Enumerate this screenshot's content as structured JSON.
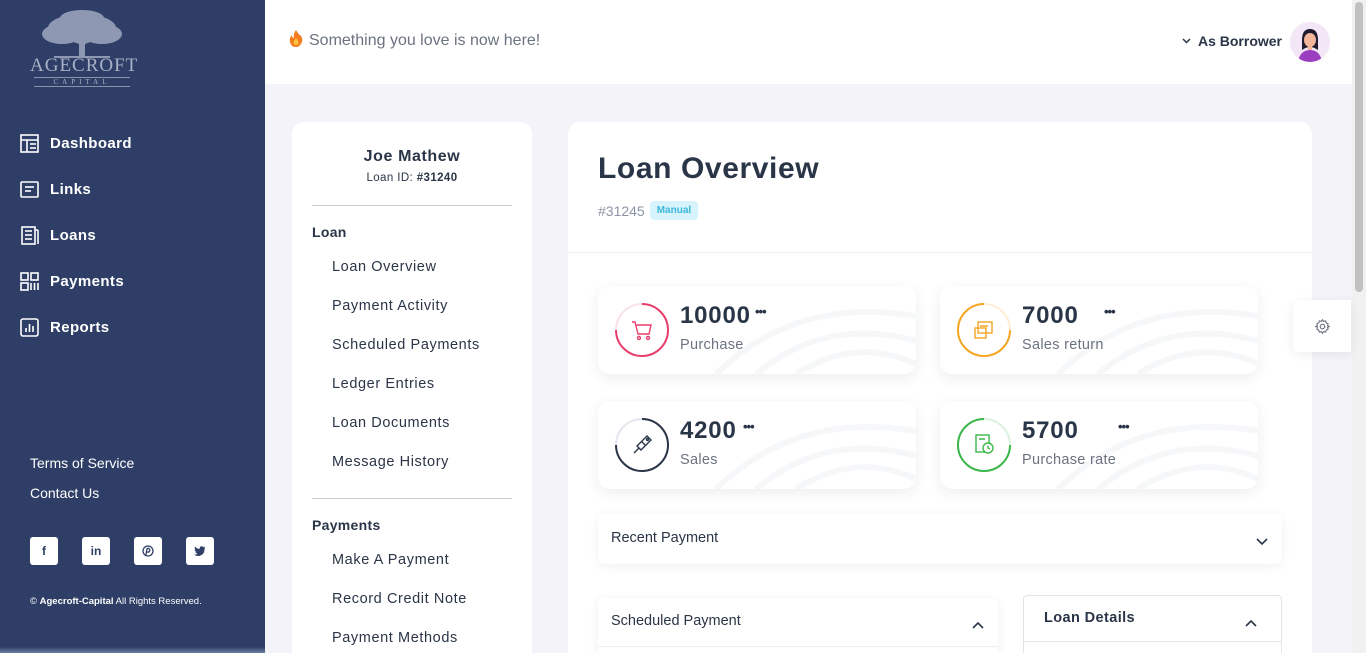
{
  "brand": {
    "name": "AGECROFT",
    "sub": "CAPITAL"
  },
  "sidebar": {
    "items": [
      {
        "label": "Dashboard",
        "icon": "dashboard-icon"
      },
      {
        "label": "Links",
        "icon": "links-icon"
      },
      {
        "label": "Loans",
        "icon": "loans-icon"
      },
      {
        "label": "Payments",
        "icon": "payments-icon"
      },
      {
        "label": "Reports",
        "icon": "reports-icon"
      }
    ],
    "links": {
      "terms": "Terms of Service",
      "contact": "Contact Us"
    },
    "socials": [
      "f",
      "in",
      "p",
      "t"
    ],
    "copyright": {
      "brand": "Agecroft-Capital",
      "text": " All Rights Reserved.",
      "symbol": "©"
    }
  },
  "header": {
    "promo": "Something you love is now here!",
    "role": "As Borrower"
  },
  "submenu": {
    "name": "Joe Mathew",
    "loan_id_label": "Loan ID:",
    "loan_id": "#31240",
    "loan_heading": "Loan",
    "loan_items": [
      "Loan Overview",
      "Payment Activity",
      "Scheduled Payments",
      "Ledger Entries",
      "Loan Documents",
      "Message History"
    ],
    "payments_heading": "Payments",
    "payment_items": [
      "Make A Payment",
      "Record Credit Note",
      "Payment Methods"
    ]
  },
  "main": {
    "title": "Loan Overview",
    "loan_number": "#31245",
    "badge": "Manual",
    "stats": [
      {
        "value": "10000",
        "label": "Purchase",
        "color": "#e83e6c",
        "icon": "cart-icon"
      },
      {
        "value": "7000",
        "label": "Sales return",
        "color": "#f5a623",
        "icon": "return-icon"
      },
      {
        "value": "4200",
        "label": "Sales",
        "color": "#2a3547",
        "icon": "tag-icon"
      },
      {
        "value": "5700",
        "label": "Purchase rate",
        "color": "#3cb64b",
        "icon": "document-icon"
      }
    ],
    "dots": "•••",
    "recent_payment": "Recent Payment",
    "scheduled_payment": "Scheduled Payment",
    "loan_details": "Loan Details"
  }
}
